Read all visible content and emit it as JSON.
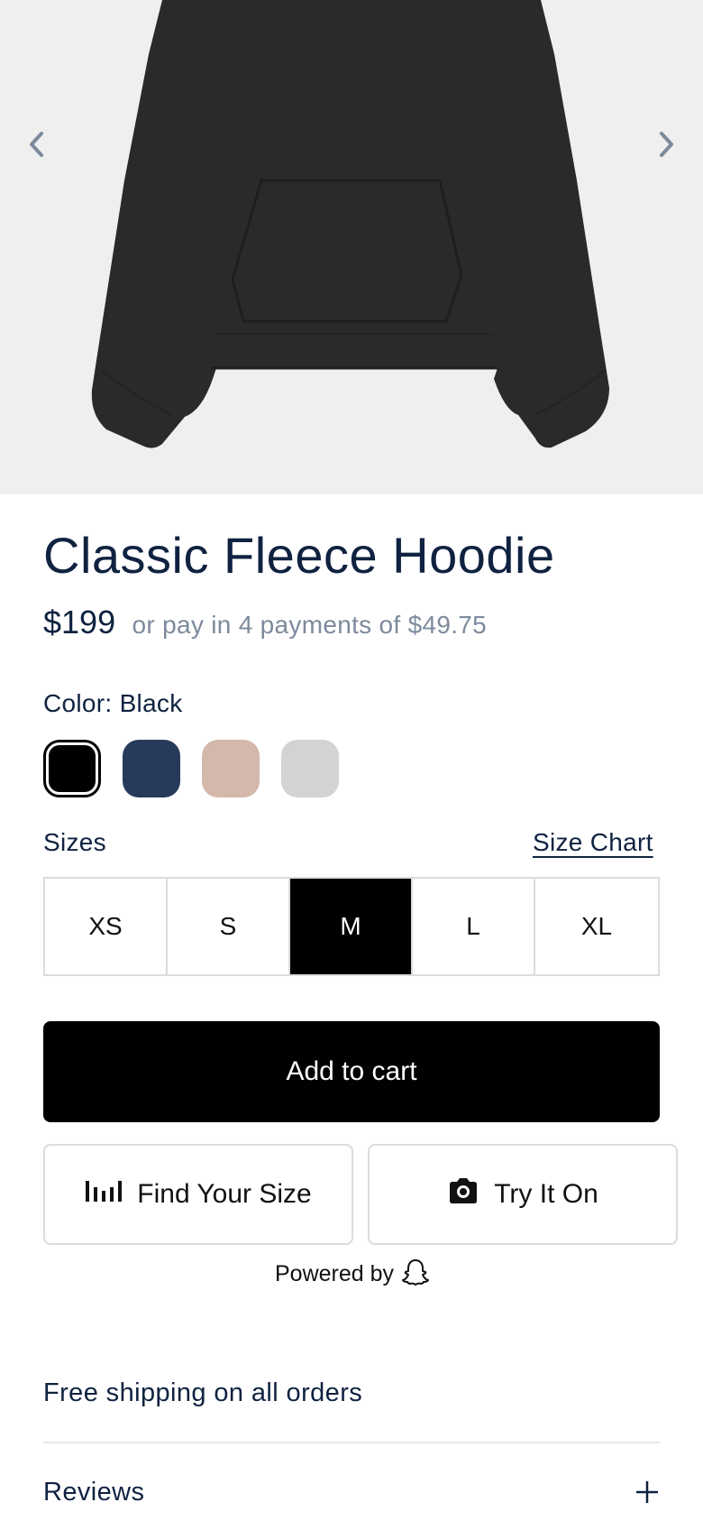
{
  "hero": {
    "prev_icon": "chevron-left-icon",
    "next_icon": "chevron-right-icon"
  },
  "product": {
    "title": "Classic Fleece Hoodie",
    "price": "$199",
    "installments": "or pay in 4 payments of $49.75"
  },
  "color": {
    "label": "Color: Black",
    "swatches": [
      {
        "name": "Black",
        "hex": "#000000",
        "selected": true
      },
      {
        "name": "Navy",
        "hex": "#283a5c",
        "selected": false
      },
      {
        "name": "Sand",
        "hex": "#d4b8ab",
        "selected": false
      },
      {
        "name": "Gray",
        "hex": "#d3d3d3",
        "selected": false
      }
    ]
  },
  "sizes": {
    "label": "Sizes",
    "chart_link": "Size Chart",
    "options": [
      "XS",
      "S",
      "M",
      "L",
      "XL"
    ],
    "selected": "M"
  },
  "actions": {
    "add_to_cart": "Add to cart",
    "find_size": "Find Your Size",
    "find_size_icon": "bar-chart-icon",
    "try_on": "Try It On",
    "try_on_icon": "camera-icon",
    "powered_by": "Powered by",
    "powered_logo": "snapchat-ghost-icon"
  },
  "info": {
    "shipping": "Free shipping on all orders",
    "reviews": "Reviews",
    "reviews_icon": "plus-icon"
  },
  "colors": {
    "text_primary": "#0f2240",
    "text_muted": "#7d8a9c",
    "hero_bg": "#efefef",
    "garment": "#2a2a2a"
  }
}
